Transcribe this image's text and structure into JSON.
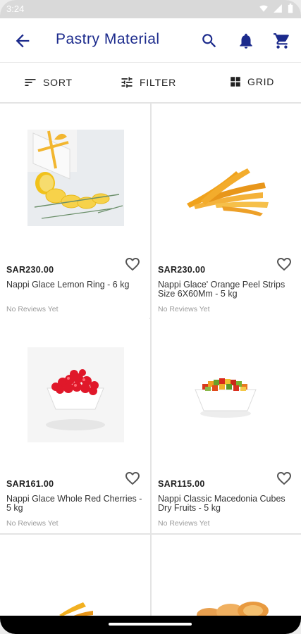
{
  "status": {
    "time": "3:24"
  },
  "header": {
    "title": "Pastry Material"
  },
  "toolbar": {
    "sort_label": "SORT",
    "filter_label": "FILTER",
    "grid_label": "GRID"
  },
  "products": [
    {
      "price": "SAR230.00",
      "name": "Nappi Glace Lemon Ring - 6 kg",
      "reviews": "No Reviews Yet"
    },
    {
      "price": "SAR230.00",
      "name": "Nappi Glace' Orange Peel Strips Size 6X60Mm - 5 kg",
      "reviews": "No Reviews Yet"
    },
    {
      "price": "SAR161.00",
      "name": "Nappi Glace Whole Red Cherries - 5 kg",
      "reviews": "No Reviews Yet"
    },
    {
      "price": "SAR115.00",
      "name": "Nappi Classic Macedonia Cubes Dry Fruits - 5 kg",
      "reviews": "No Reviews Yet"
    }
  ],
  "colors": {
    "brand": "#1b2a8c",
    "divider": "#e4e4e4"
  }
}
